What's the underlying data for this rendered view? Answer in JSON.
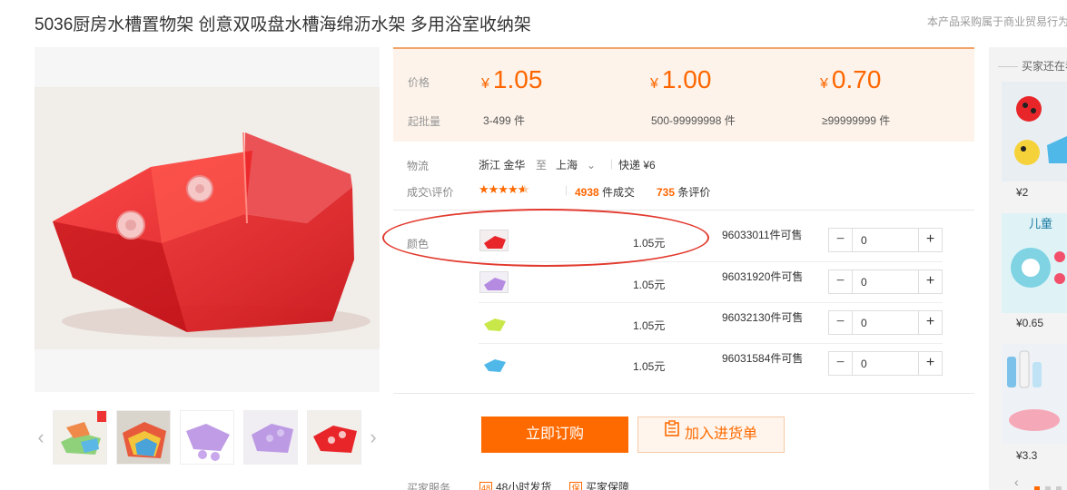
{
  "product": {
    "title": "5036厨房水槽置物架 创意双吸盘水槽海绵沥水架 多用浴室收纳架",
    "notice": "本产品采购属于商业贸易行为"
  },
  "pricing": {
    "price_label": "价格",
    "moq_label": "起批量",
    "currency": "¥",
    "tiers": [
      {
        "price": "1.05",
        "range": "3-499 件"
      },
      {
        "price": "1.00",
        "range": "500-99999998 件"
      },
      {
        "price": "0.70",
        "range": "≥99999999 件"
      }
    ]
  },
  "logistics": {
    "label": "物流",
    "from": "浙江 金华",
    "to_word": "至",
    "to": "上海",
    "express": "快递 ¥6"
  },
  "reviews": {
    "label": "成交\\评价",
    "rating": 4.5,
    "deals_count": "4938",
    "deals_suffix": "件成交",
    "review_count": "735",
    "review_suffix": "条评价"
  },
  "sku": {
    "label": "颜色",
    "colors": {
      "red": "#e8262a",
      "purple": "#b48be0",
      "green": "#c8e84a",
      "blue": "#4fb8e8"
    },
    "rows": [
      {
        "swatch": "red",
        "price": "1.05元",
        "stock": "96033011件可售",
        "qty": "0"
      },
      {
        "swatch": "purple",
        "price": "1.05元",
        "stock": "96031920件可售",
        "qty": "0"
      },
      {
        "swatch": "green",
        "price": "1.05元",
        "stock": "96032130件可售",
        "qty": "0"
      },
      {
        "swatch": "blue",
        "price": "1.05元",
        "stock": "96031584件可售",
        "qty": "0"
      }
    ]
  },
  "actions": {
    "buy_now": "立即订购",
    "add_to_list": "加入进货单"
  },
  "services": {
    "label": "买家服务",
    "items": [
      {
        "badge": "48",
        "text": "48小时发货"
      },
      {
        "badge": "保",
        "text": "买家保障"
      }
    ]
  },
  "sidebar": {
    "title": "买家还在看",
    "items": [
      {
        "price": "¥2"
      },
      {
        "price": "¥0.65",
        "caption": "儿童"
      },
      {
        "price": "¥3.3"
      }
    ]
  },
  "accent_color": "#ff6a00",
  "annotation_color": "#e23a2e"
}
